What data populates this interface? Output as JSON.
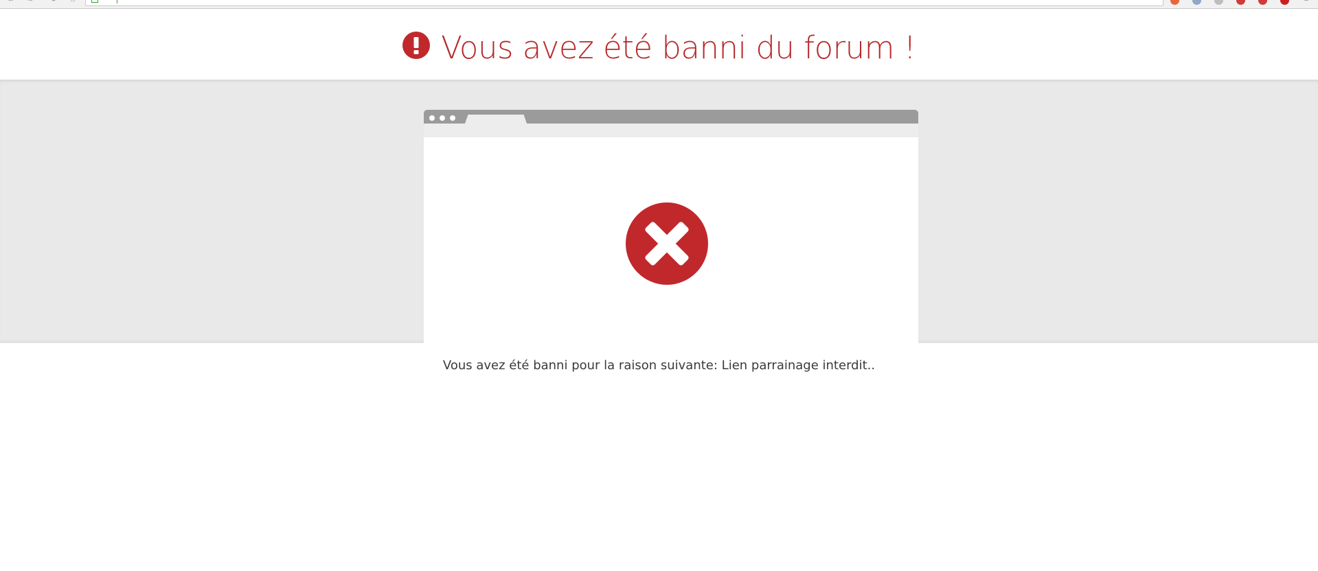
{
  "page": {
    "title": "Vous avez été banni du forum !",
    "reason": "Vous avez été banni pour la raison suivante: Lien parrainage interdit.."
  },
  "icons": {
    "title_icon": "exclamation-circle-icon",
    "main_icon": "error-x-circle-icon"
  },
  "colors": {
    "accent": "#b52a2a",
    "error_circle": "#c0282b",
    "band": "#e9e9e9",
    "mock_titlebar": "#9b9b9b",
    "text": "#3a3a3a"
  }
}
